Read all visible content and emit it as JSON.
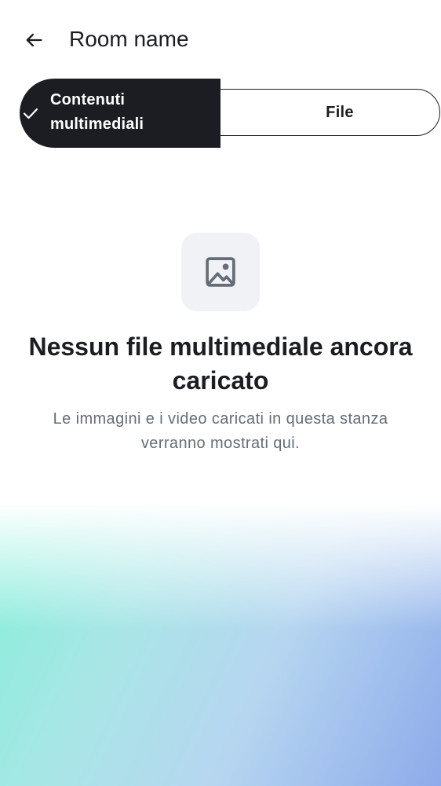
{
  "header": {
    "title": "Room name",
    "back_icon": "arrow-left-icon"
  },
  "tabs": {
    "selected": "media",
    "items": [
      {
        "id": "media",
        "label": "Contenuti\nmultimediali",
        "icon": "checkmark-icon"
      },
      {
        "id": "files",
        "label": "File"
      }
    ]
  },
  "empty_state": {
    "icon": "image-icon",
    "title": "Nessun file multimediale ancora caricato",
    "subtitle": "Le immagini e i video caricati in questa stanza verranno mostrati qui."
  },
  "colors": {
    "text_primary": "#1b1d22",
    "text_secondary": "#656d77",
    "selected_segment": "#1b1d22",
    "icon_bg": "#f0f2f5",
    "gradient_green": "#86efd9",
    "gradient_blue": "#8eaaea"
  }
}
